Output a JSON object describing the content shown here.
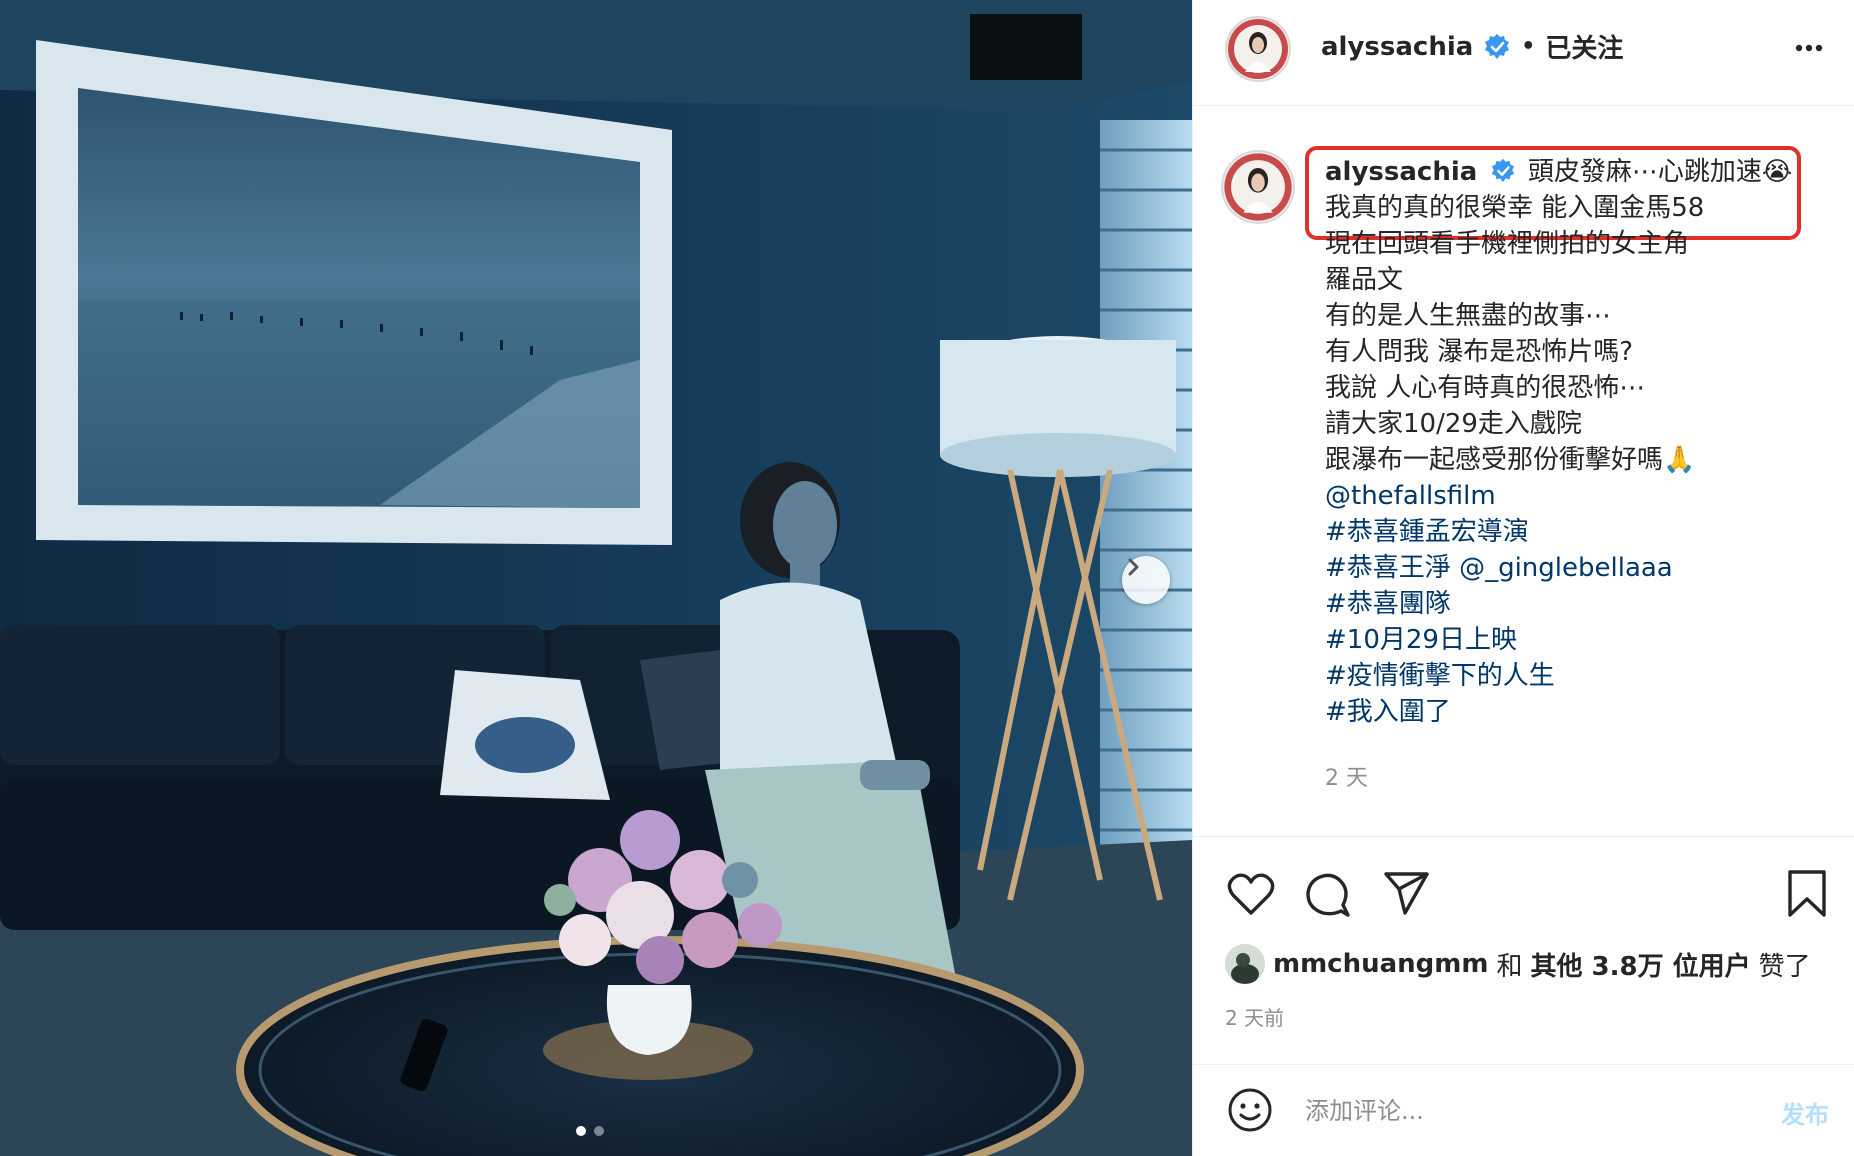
{
  "header": {
    "username": "alyssachia",
    "separator": "•",
    "follow_status": "已关注",
    "avatar_icon": "avatar-portrait",
    "verified_icon": "verified-badge-icon",
    "more_icon": "more-options-icon"
  },
  "caption": {
    "username": "alyssachia",
    "first_line": "頭皮發麻⋯心跳加速😭",
    "lines": [
      "我真的真的很榮幸 能入圍金馬58",
      "現在回頭看手機裡側拍的女主角",
      "羅品文",
      "有的是人生無盡的故事⋯",
      "有人問我 瀑布是恐怖片嗎?",
      "我說 人心有時真的很恐怖⋯",
      "請大家10/29走入戲院",
      "跟瀑布一起感受那份衝擊好嗎🙏"
    ],
    "mention": "@thefallsfilm",
    "hashtags": [
      "#恭喜鍾孟宏導演",
      "#恭喜王淨",
      "#恭喜團隊",
      "#10月29日上映",
      "#疫情衝擊下的人生",
      "#我入圍了"
    ],
    "hashtag2_mention": "@_ginglebellaaa",
    "time": "2 天",
    "highlight_color": "#e0302a"
  },
  "actions": {
    "like_icon": "heart-icon",
    "comment_icon": "comment-icon",
    "share_icon": "share-icon",
    "save_icon": "bookmark-icon"
  },
  "likes": {
    "user": "mmchuangmm",
    "and": "和",
    "others": "其他 3.8万 位用户",
    "suffix": "赞了",
    "post_time": "2 天前"
  },
  "comment": {
    "placeholder": "添加评论...",
    "post_label": "发布",
    "emoji_icon": "smiley-icon"
  },
  "carousel": {
    "next_icon": "chevron-right-icon",
    "slides": 2,
    "active_slide": 1
  },
  "colors": {
    "link": "#00376b",
    "verified": "#3897f0",
    "muted": "#8e8e8e",
    "post_disabled": "#b2dffc"
  }
}
